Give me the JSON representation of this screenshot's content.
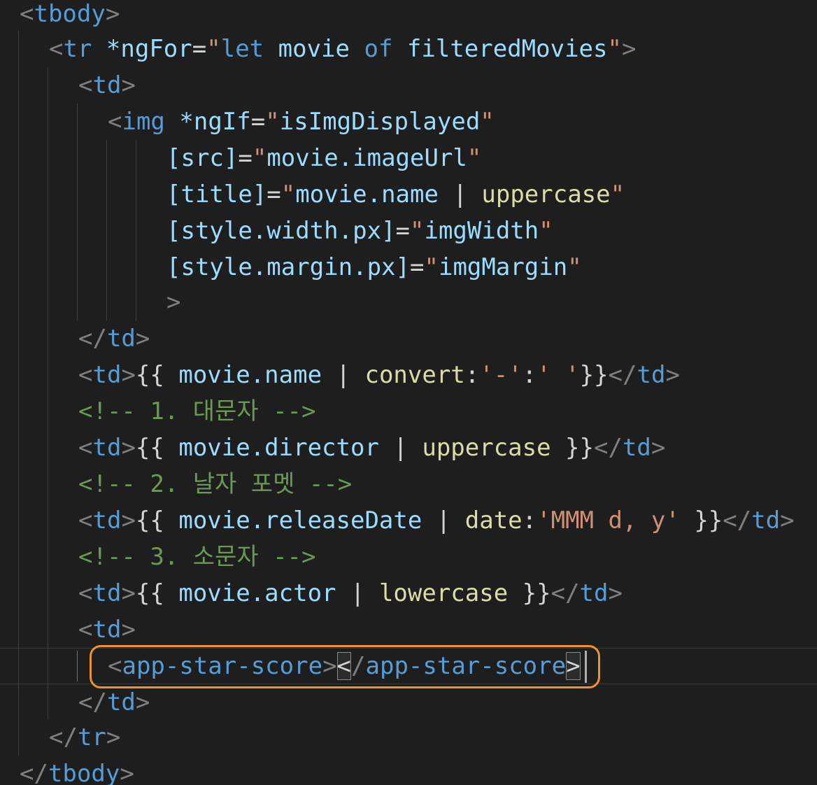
{
  "code": {
    "lines": [
      {
        "tokens": [
          {
            "t": "p",
            "v": "<"
          },
          {
            "t": "tag",
            "v": "tbody"
          },
          {
            "t": "p",
            "v": ">"
          }
        ]
      },
      {
        "tokens": [
          {
            "t": "p",
            "v": "<"
          },
          {
            "t": "tag",
            "v": "tr"
          },
          {
            "t": "txt",
            "v": " "
          },
          {
            "t": "attr",
            "v": "*ngFor"
          },
          {
            "t": "txt",
            "v": "="
          },
          {
            "t": "str",
            "v": "\""
          },
          {
            "t": "tag",
            "v": "let"
          },
          {
            "t": "txt",
            "v": " "
          },
          {
            "t": "attr",
            "v": "movie"
          },
          {
            "t": "txt",
            "v": " "
          },
          {
            "t": "tag",
            "v": "of"
          },
          {
            "t": "txt",
            "v": " "
          },
          {
            "t": "attr",
            "v": "filteredMovies"
          },
          {
            "t": "str",
            "v": "\""
          },
          {
            "t": "p",
            "v": ">"
          }
        ]
      },
      {
        "tokens": [
          {
            "t": "p",
            "v": "<"
          },
          {
            "t": "tag",
            "v": "td"
          },
          {
            "t": "p",
            "v": ">"
          }
        ]
      },
      {
        "tokens": [
          {
            "t": "p",
            "v": "<"
          },
          {
            "t": "tag",
            "v": "img"
          },
          {
            "t": "txt",
            "v": " "
          },
          {
            "t": "attr",
            "v": "*ngIf"
          },
          {
            "t": "txt",
            "v": "="
          },
          {
            "t": "str",
            "v": "\""
          },
          {
            "t": "attr",
            "v": "isImgDisplayed"
          },
          {
            "t": "str",
            "v": "\""
          }
        ]
      },
      {
        "tokens": [
          {
            "t": "attr",
            "v": "[src]"
          },
          {
            "t": "txt",
            "v": "="
          },
          {
            "t": "str",
            "v": "\""
          },
          {
            "t": "attr",
            "v": "movie.imageUrl"
          },
          {
            "t": "str",
            "v": "\""
          }
        ]
      },
      {
        "tokens": [
          {
            "t": "attr",
            "v": "[title]"
          },
          {
            "t": "txt",
            "v": "="
          },
          {
            "t": "str",
            "v": "\""
          },
          {
            "t": "attr",
            "v": "movie.name"
          },
          {
            "t": "txt",
            "v": " | "
          },
          {
            "t": "fn",
            "v": "uppercase"
          },
          {
            "t": "str",
            "v": "\""
          }
        ]
      },
      {
        "tokens": [
          {
            "t": "attr",
            "v": "[style.width.px]"
          },
          {
            "t": "txt",
            "v": "="
          },
          {
            "t": "str",
            "v": "\""
          },
          {
            "t": "attr",
            "v": "imgWidth"
          },
          {
            "t": "str",
            "v": "\""
          }
        ]
      },
      {
        "tokens": [
          {
            "t": "attr",
            "v": "[style.margin.px]"
          },
          {
            "t": "txt",
            "v": "="
          },
          {
            "t": "str",
            "v": "\""
          },
          {
            "t": "attr",
            "v": "imgMargin"
          },
          {
            "t": "str",
            "v": "\""
          }
        ]
      },
      {
        "tokens": [
          {
            "t": "p",
            "v": ">"
          }
        ]
      },
      {
        "tokens": [
          {
            "t": "p",
            "v": "</"
          },
          {
            "t": "tag",
            "v": "td"
          },
          {
            "t": "p",
            "v": ">"
          }
        ]
      },
      {
        "tokens": [
          {
            "t": "p",
            "v": "<"
          },
          {
            "t": "tag",
            "v": "td"
          },
          {
            "t": "p",
            "v": ">"
          },
          {
            "t": "txt",
            "v": "{{ "
          },
          {
            "t": "attr",
            "v": "movie.name"
          },
          {
            "t": "txt",
            "v": " | "
          },
          {
            "t": "fn",
            "v": "convert"
          },
          {
            "t": "txt",
            "v": ":"
          },
          {
            "t": "str",
            "v": "'-'"
          },
          {
            "t": "txt",
            "v": ":"
          },
          {
            "t": "str",
            "v": "' '"
          },
          {
            "t": "txt",
            "v": "}}"
          },
          {
            "t": "p",
            "v": "</"
          },
          {
            "t": "tag",
            "v": "td"
          },
          {
            "t": "p",
            "v": ">"
          }
        ]
      },
      {
        "tokens": [
          {
            "t": "cmt",
            "v": "<!-- 1. 대문자 -->"
          }
        ]
      },
      {
        "tokens": [
          {
            "t": "p",
            "v": "<"
          },
          {
            "t": "tag",
            "v": "td"
          },
          {
            "t": "p",
            "v": ">"
          },
          {
            "t": "txt",
            "v": "{{ "
          },
          {
            "t": "attr",
            "v": "movie.director"
          },
          {
            "t": "txt",
            "v": " | "
          },
          {
            "t": "fn",
            "v": "uppercase"
          },
          {
            "t": "txt",
            "v": " }}"
          },
          {
            "t": "p",
            "v": "</"
          },
          {
            "t": "tag",
            "v": "td"
          },
          {
            "t": "p",
            "v": ">"
          }
        ]
      },
      {
        "tokens": [
          {
            "t": "cmt",
            "v": "<!-- 2. 날자 포멧 -->"
          }
        ]
      },
      {
        "tokens": [
          {
            "t": "p",
            "v": "<"
          },
          {
            "t": "tag",
            "v": "td"
          },
          {
            "t": "p",
            "v": ">"
          },
          {
            "t": "txt",
            "v": "{{ "
          },
          {
            "t": "attr",
            "v": "movie.releaseDate"
          },
          {
            "t": "txt",
            "v": " | "
          },
          {
            "t": "fn",
            "v": "date"
          },
          {
            "t": "txt",
            "v": ":"
          },
          {
            "t": "str",
            "v": "'MMM d, y'"
          },
          {
            "t": "txt",
            "v": " }}"
          },
          {
            "t": "p",
            "v": "</"
          },
          {
            "t": "tag",
            "v": "td"
          },
          {
            "t": "p",
            "v": ">"
          }
        ]
      },
      {
        "tokens": [
          {
            "t": "cmt",
            "v": "<!-- 3. 소문자 -->"
          }
        ]
      },
      {
        "tokens": [
          {
            "t": "p",
            "v": "<"
          },
          {
            "t": "tag",
            "v": "td"
          },
          {
            "t": "p",
            "v": ">"
          },
          {
            "t": "txt",
            "v": "{{ "
          },
          {
            "t": "attr",
            "v": "movie.actor"
          },
          {
            "t": "txt",
            "v": " | "
          },
          {
            "t": "fn",
            "v": "lowercase"
          },
          {
            "t": "txt",
            "v": " }}"
          },
          {
            "t": "p",
            "v": "</"
          },
          {
            "t": "tag",
            "v": "td"
          },
          {
            "t": "p",
            "v": ">"
          }
        ]
      },
      {
        "tokens": [
          {
            "t": "p",
            "v": "<"
          },
          {
            "t": "tag",
            "v": "td"
          },
          {
            "t": "p",
            "v": ">"
          }
        ]
      },
      {
        "tokens": [
          {
            "t": "p",
            "v": "<"
          },
          {
            "t": "tag",
            "v": "app-star-score"
          },
          {
            "t": "p",
            "v": ">"
          },
          {
            "t": "bm",
            "v": "<"
          },
          {
            "t": "p",
            "v": "/"
          },
          {
            "t": "tag",
            "v": "app-star-score"
          },
          {
            "t": "bm",
            "v": ">"
          }
        ]
      },
      {
        "tokens": [
          {
            "t": "p",
            "v": "</"
          },
          {
            "t": "tag",
            "v": "td"
          },
          {
            "t": "p",
            "v": ">"
          }
        ]
      },
      {
        "tokens": [
          {
            "t": "p",
            "v": "</"
          },
          {
            "t": "tag",
            "v": "tr"
          },
          {
            "t": "p",
            "v": ">"
          }
        ]
      },
      {
        "tokens": [
          {
            "t": "p",
            "v": "</"
          },
          {
            "t": "tag",
            "v": "tbody"
          },
          {
            "t": "p",
            "v": ">"
          }
        ]
      }
    ]
  },
  "theme": {
    "background": "#1e1e1e",
    "tag": "#569cd6",
    "attribute": "#9cdcfe",
    "string": "#ce9178",
    "function": "#dcdcaa",
    "comment": "#6a9955",
    "punctuation": "#808080",
    "highlight_border": "#f0922b"
  }
}
